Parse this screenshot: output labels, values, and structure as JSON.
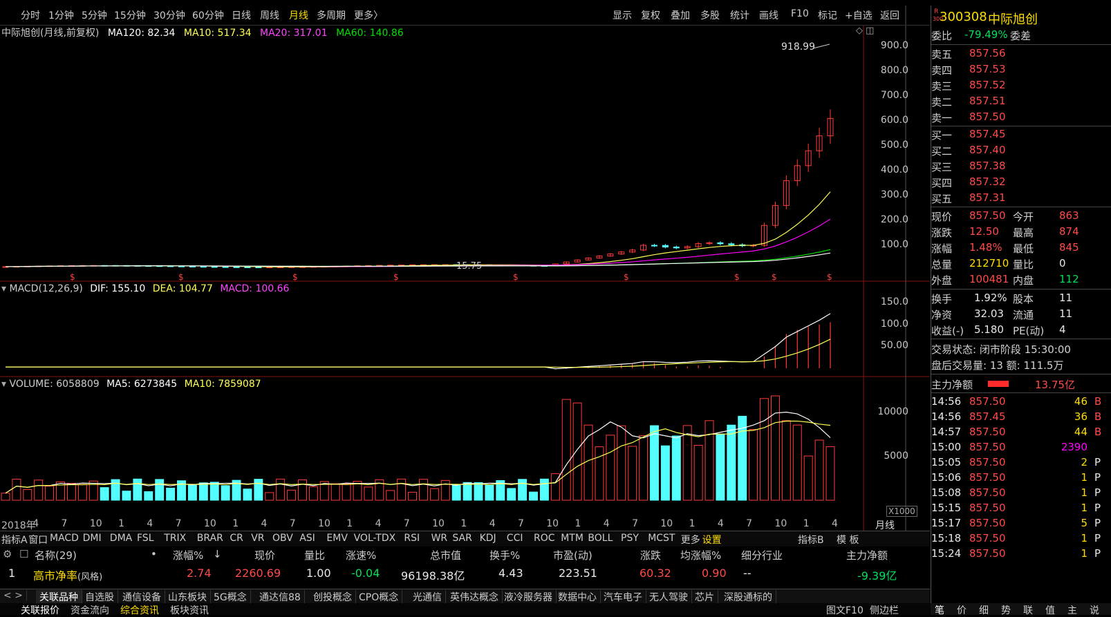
{
  "toolbar": {
    "periods": [
      "分时",
      "1分钟",
      "5分钟",
      "15分钟",
      "30分钟",
      "60分钟",
      "日线",
      "周线",
      "月线",
      "多周期",
      "更多〉"
    ],
    "active_period": "月线",
    "tools": [
      "显示",
      "复权",
      "叠加",
      "多股",
      "统计",
      "画线",
      "F10",
      "标记",
      "+自选",
      "返回"
    ]
  },
  "kline": {
    "title": "中际旭创(月线,前复权)",
    "ma120": "MA120: 82.34",
    "ma10": "MA10: 517.34",
    "ma20": "MA20: 317.01",
    "ma60": "MA60: 140.86",
    "high_label": "918.99",
    "low_label": "15.75",
    "y_ticks": [
      "900.0",
      "800.0",
      "700.0",
      "600.0",
      "500.0",
      "400.0",
      "300.0",
      "200.0",
      "100.0"
    ]
  },
  "macd": {
    "title": "MACD(12,26,9)",
    "dif": "DIF: 155.10",
    "dea": "DEA: 104.77",
    "macd": "MACD: 100.66",
    "y_ticks": [
      "150.0",
      "100.0",
      "50.00"
    ]
  },
  "volume": {
    "title": "VOLUME: 6058809",
    "ma5": "MA5: 6273845",
    "ma10": "MA10: 7859087",
    "y_ticks": [
      "10000",
      "5000"
    ],
    "unit": "X1000"
  },
  "x_axis": {
    "labels": [
      "2018年",
      "4",
      "7",
      "10",
      "1",
      "4",
      "7",
      "10",
      "1",
      "4",
      "7",
      "10",
      "1",
      "4",
      "7",
      "10",
      "1",
      "4",
      "7",
      "10",
      "1",
      "4",
      "7",
      "10",
      "1",
      "4",
      "7",
      "10",
      "1",
      "4"
    ],
    "period": "月线"
  },
  "indicator_bar": [
    "指标A",
    "窗口",
    "MACD",
    "DMI",
    "DMA",
    "FSL",
    "TRIX",
    "BRAR",
    "CR",
    "VR",
    "OBV",
    "ASI",
    "EMV",
    "VOL-TDX",
    "RSI",
    "WR",
    "SAR",
    "KDJ",
    "CCI",
    "ROC",
    "MTM",
    "BOLL",
    "PSY",
    "MCST",
    "更多",
    "设置"
  ],
  "indicator_right": [
    "指标B",
    "模 板"
  ],
  "table": {
    "headers": [
      "名称(29)",
      "•",
      "涨幅%",
      "↓",
      "现价",
      "量比",
      "涨速%",
      "总市值",
      "换手%",
      "市盈(动)",
      "涨跌",
      "均涨幅%",
      "细分行业",
      "主力净额"
    ],
    "row": {
      "index": "1",
      "name": "高市净率",
      "name_suffix": "(风格)",
      "change_pct": "2.74",
      "price": "2260.69",
      "vol_ratio": "1.00",
      "speed": "-0.04",
      "mkt_cap": "96198.38亿",
      "turnover": "4.43",
      "pe": "223.51",
      "change": "60.32",
      "avg_change": "0.90",
      "industry": "--",
      "net_flow": "-9.39亿"
    }
  },
  "tabs": [
    "关联品种",
    "自选股",
    "通信设备",
    "山东板块",
    "5G概念",
    "通达信88",
    "创投概念",
    "CPO概念",
    "光通信",
    "英伟达概念",
    "液冷服务器",
    "数据中心",
    "汽车电子",
    "无人驾驶",
    "芯片",
    "深股通标的"
  ],
  "bottom_tabs": [
    "关联报价",
    "资金流向",
    "综合资讯",
    "板块资讯"
  ],
  "bottom_right": [
    "图文F10",
    "侧边栏"
  ],
  "right_panel": {
    "code": "300308",
    "name": "中际旭创",
    "badge_top": "R",
    "badge_bottom": "300",
    "weibi_label": "委比",
    "weibi": "-79.49%",
    "weicha_label": "委差",
    "asks": [
      {
        "label": "卖五",
        "price": "857.56"
      },
      {
        "label": "卖四",
        "price": "857.53"
      },
      {
        "label": "卖三",
        "price": "857.52"
      },
      {
        "label": "卖二",
        "price": "857.51"
      },
      {
        "label": "卖一",
        "price": "857.50"
      }
    ],
    "bids": [
      {
        "label": "买一",
        "price": "857.45"
      },
      {
        "label": "买二",
        "price": "857.40"
      },
      {
        "label": "买三",
        "price": "857.38"
      },
      {
        "label": "买四",
        "price": "857.32"
      },
      {
        "label": "买五",
        "price": "857.31"
      }
    ],
    "quote": [
      {
        "l1": "现价",
        "v1": "857.50",
        "l2": "今开",
        "v2": "863"
      },
      {
        "l1": "涨跌",
        "v1": "12.50",
        "l2": "最高",
        "v2": "874"
      },
      {
        "l1": "涨幅",
        "v1": "1.48%",
        "l2": "最低",
        "v2": "845"
      },
      {
        "l1": "总量",
        "v1": "212710",
        "l2": "量比",
        "v2": "0"
      },
      {
        "l1": "外盘",
        "v1": "100481",
        "l2": "内盘",
        "v2": "112"
      }
    ],
    "fund": [
      {
        "l1": "换手",
        "v1": "1.92%",
        "l2": "股本",
        "v2": "11"
      },
      {
        "l1": "净资",
        "v1": "32.03",
        "l2": "流通",
        "v2": "11"
      },
      {
        "l1": "收益(-)",
        "v1": "5.180",
        "l2": "PE(动)",
        "v2": "4"
      }
    ],
    "trade_status": "交易状态: 闭市阶段 15:30:00",
    "after_hours": "盘后交易量: 13  额: 111.5万",
    "net_label": "主力净额",
    "net_value": "13.75亿",
    "ticks": [
      {
        "time": "14:56",
        "price": "857.50",
        "vol": "46",
        "bs": "B"
      },
      {
        "time": "14:56",
        "price": "857.45",
        "vol": "36",
        "bs": "B"
      },
      {
        "time": "14:57",
        "price": "857.50",
        "vol": "44",
        "bs": "B"
      },
      {
        "time": "15:00",
        "price": "857.50",
        "vol": "2390",
        "bs": ""
      },
      {
        "time": "15:05",
        "price": "857.50",
        "vol": "2",
        "bs": "P"
      },
      {
        "time": "15:06",
        "price": "857.50",
        "vol": "1",
        "bs": "P"
      },
      {
        "time": "15:08",
        "price": "857.50",
        "vol": "1",
        "bs": "P"
      },
      {
        "time": "15:15",
        "price": "857.50",
        "vol": "1",
        "bs": "P"
      },
      {
        "time": "15:17",
        "price": "857.50",
        "vol": "5",
        "bs": "P"
      },
      {
        "time": "15:18",
        "price": "857.50",
        "vol": "1",
        "bs": "P"
      },
      {
        "time": "15:24",
        "price": "857.50",
        "vol": "1",
        "bs": "P"
      }
    ],
    "side_tabs": [
      "笔",
      "价",
      "细",
      "势",
      "联",
      "值",
      "主",
      "说"
    ]
  },
  "colors": {
    "up": "#ff3b3b",
    "down": "#54ffff",
    "ma10": "#ffff55",
    "ma20": "#ff00ff",
    "ma60": "#00e000",
    "ma120": "#ffffff"
  }
}
